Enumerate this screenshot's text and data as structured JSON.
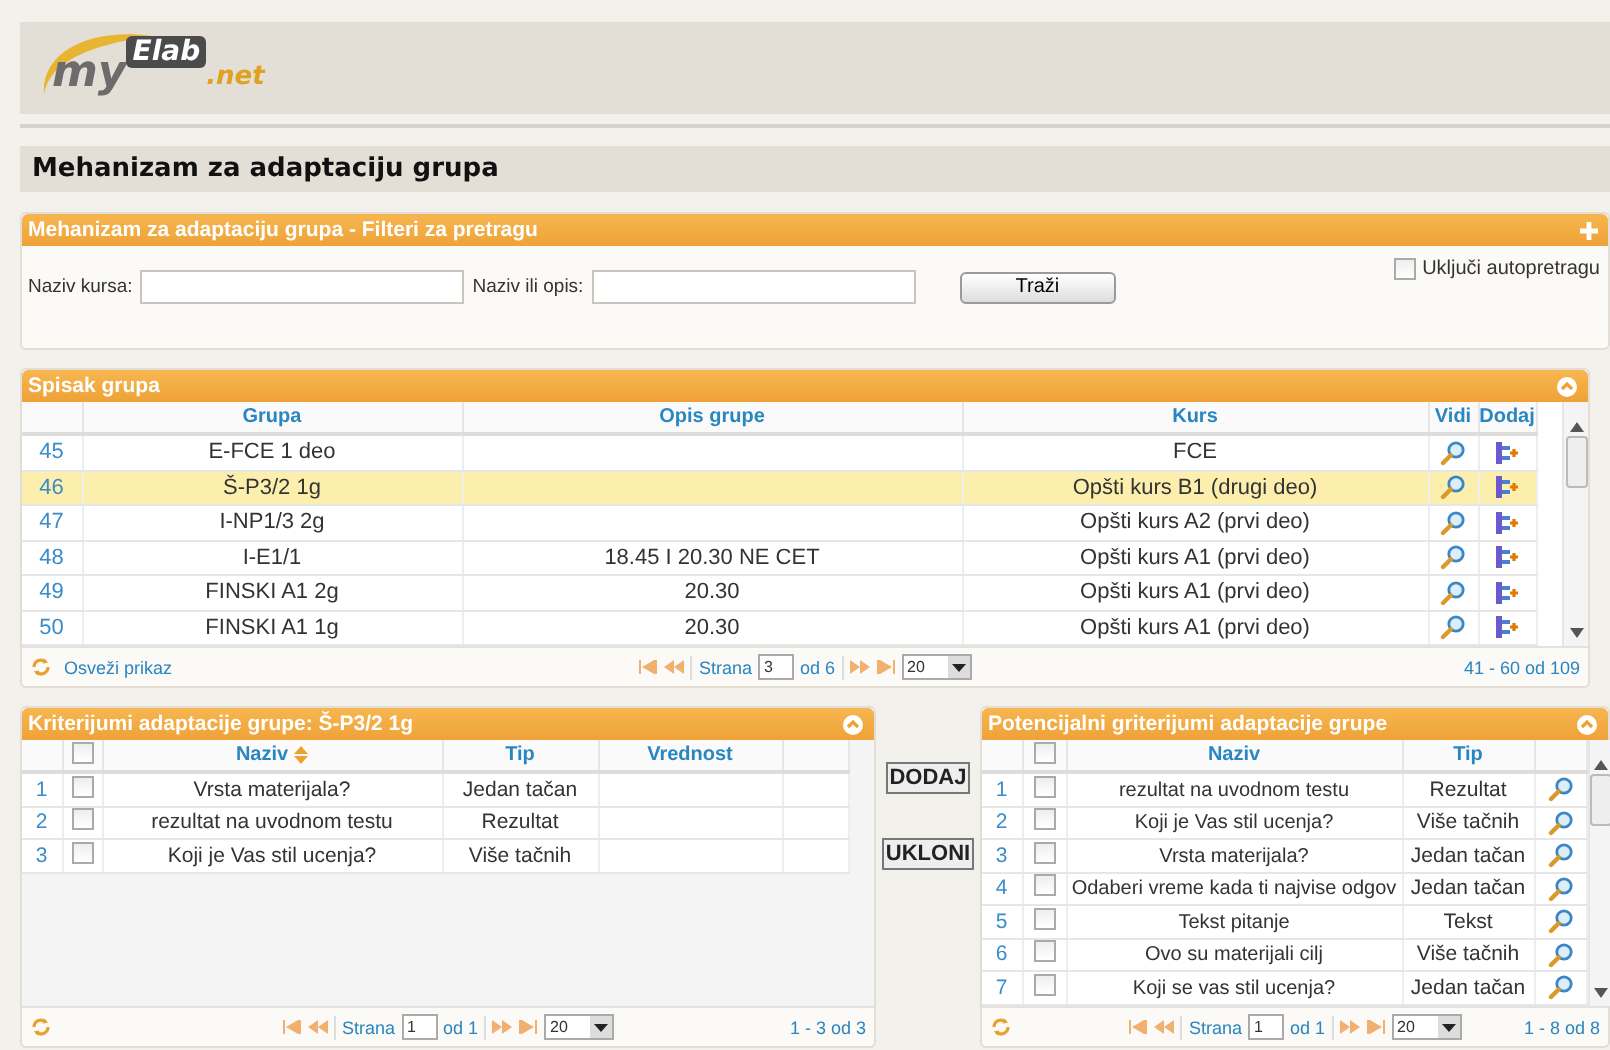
{
  "logo": {
    "prefix": "my",
    "boxed": "Elab",
    "suffix": ".net"
  },
  "page_title": "Mehanizam za adaptaciju grupa",
  "filter_panel": {
    "title": "Mehanizam za adaptaciju grupa - Filteri za pretragu",
    "fields": [
      {
        "label": "Naziv kursa:"
      },
      {
        "label": "Naziv ili opis:"
      }
    ],
    "search_button": "Traži",
    "autosearch": {
      "label": "Uključi autopretragu",
      "checked": false
    }
  },
  "groups_panel": {
    "title": "Spisak grupa",
    "columns": [
      "Grupa",
      "Opis grupe",
      "Kurs",
      "Vidi",
      "Dodaj"
    ],
    "rows": [
      {
        "num": "45",
        "group": "E-FCE 1 deo",
        "course": "FCE",
        "selected": false
      },
      {
        "num": "46",
        "group": "Š-P3/2 1g",
        "course": "Opšti kurs B1 (drugi deo)",
        "selected": true
      },
      {
        "num": "47",
        "group": "I-NP1/3 2g",
        "course": "Opšti kurs A2 (prvi deo)",
        "selected": false
      },
      {
        "num": "48",
        "group": "I-E1/1",
        "description": "18.45 I 20.30 NE CET",
        "course": "Opšti kurs A1 (prvi deo)",
        "selected": false
      },
      {
        "num": "49",
        "group": "FINSKI A1 2g",
        "description": "20.30",
        "course": "Opšti kurs A1 (prvi deo)",
        "selected": false
      },
      {
        "num": "50",
        "group": "FINSKI A1 1g",
        "description": "20.30",
        "course": "Opšti kurs A1 (prvi deo)",
        "selected": false
      }
    ],
    "refresh_link": "Osveži prikaz",
    "pager": {
      "page_label": "Strana",
      "page": "3",
      "total": "od 6",
      "page_size": "20",
      "summary": "41 - 60 od 109"
    }
  },
  "criteria_panel": {
    "title": "Kriterijumi adaptacije grupe: Š-P3/2 1g",
    "all_checked": false,
    "columns": [
      {
        "label": "Naziv",
        "sorted": true
      },
      {
        "label": "Tip",
        "sorted": false
      },
      {
        "label": "Vrednost",
        "sorted": false
      }
    ],
    "rows": [
      {
        "num": "1",
        "name": "Vrsta materijala?",
        "type": "Jedan tačan",
        "checked": false
      },
      {
        "num": "2",
        "name": "rezultat na uvodnom testu",
        "type": "Rezultat",
        "checked": false
      },
      {
        "num": "3",
        "name": "Koji je Vas stil ucenja?",
        "type": "Više tačnih",
        "checked": false
      }
    ],
    "pager": {
      "page_label": "Strana",
      "page": "1",
      "total": "od 1",
      "page_size": "20",
      "summary": "1 - 3 od 3"
    }
  },
  "buttons": [
    "DODAJ",
    "UKLONI"
  ],
  "potential_panel": {
    "title": "Potencijalni griterijumi adaptacije grupe",
    "all_checked": false,
    "columns": [
      "Naziv",
      "Tip"
    ],
    "rows": [
      {
        "num": "1",
        "name": "rezultat na uvodnom testu",
        "type": "Rezultat",
        "checked": false
      },
      {
        "num": "2",
        "name": "Koji je Vas stil ucenja?",
        "type": "Više tačnih",
        "checked": false
      },
      {
        "num": "3",
        "name": "Vrsta materijala?",
        "type": "Jedan tačan",
        "checked": false
      },
      {
        "num": "4",
        "name": "Odaberi vreme kada ti najvise odgov",
        "type": "Jedan tačan",
        "checked": false
      },
      {
        "num": "5",
        "name": "Tekst pitanje",
        "type": "Tekst",
        "checked": false
      },
      {
        "num": "6",
        "name": "Ovo su materijali cilj",
        "type": "Više tačnih",
        "checked": false
      },
      {
        "num": "7",
        "name": "Koji se vas stil ucenja?",
        "type": "Jedan tačan",
        "checked": false
      }
    ],
    "pager": {
      "page_label": "Strana",
      "page": "1",
      "total": "od 1",
      "page_size": "20",
      "summary": "1 - 8 od 8"
    }
  }
}
